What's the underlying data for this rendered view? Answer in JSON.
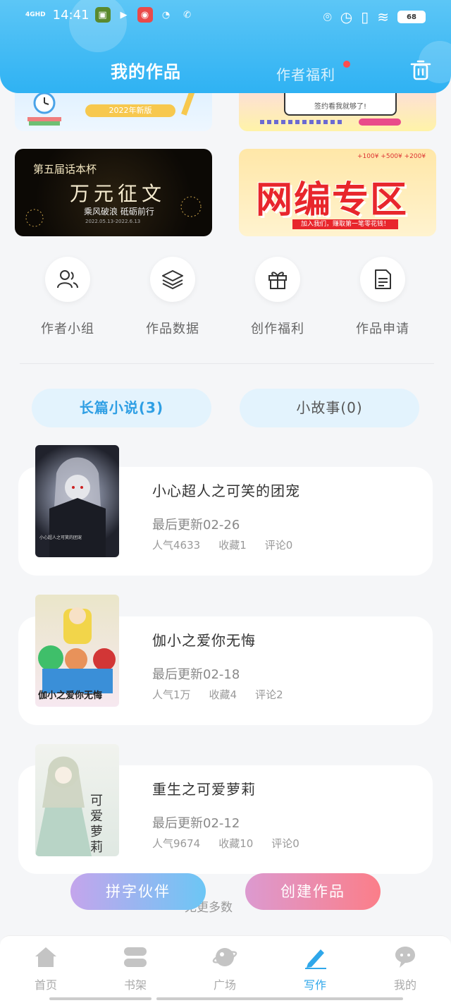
{
  "status_bar": {
    "network": "4GHD",
    "time": "14:41",
    "battery": "68"
  },
  "header": {
    "tab_my_works": "我的作品",
    "tab_author_benefits": "作者福利"
  },
  "banners": {
    "b1_pill": "2022年新版",
    "b2_card_text": "签约看我就够了!",
    "b3_line1": "第五届话本杯",
    "b3_line2": "万元征文",
    "b3_line3": "乘风破浪 砥砺前行",
    "b3_line4": "2022.05.13-2022.6.13",
    "b4_title": "网编专区",
    "b4_strip": "加入我们，赚取第一笔零花钱！",
    "b4_money": "+100¥ +500¥ +200¥"
  },
  "quick_actions": [
    {
      "label": "作者小组"
    },
    {
      "label": "作品数据"
    },
    {
      "label": "创作福利"
    },
    {
      "label": "作品申请"
    }
  ],
  "categories": {
    "novel": "长篇小说(3)",
    "story": "小故事(0)"
  },
  "works": [
    {
      "title": "小心超人之可笑的团宠",
      "update": "最后更新02-26",
      "popularity": "人气4633",
      "favorites": "收藏1",
      "comments": "评论0",
      "cover_text": "小心超人之可笑的团宠"
    },
    {
      "title": "伽小之爱你无悔",
      "update": "最后更新02-18",
      "popularity": "人气1万",
      "favorites": "收藏4",
      "comments": "评论2",
      "cover_text": "伽小之爱你无悔"
    },
    {
      "title": "重生之可爱萝莉",
      "update": "最后更新02-12",
      "popularity": "人气9674",
      "favorites": "收藏10",
      "comments": "评论0",
      "cover_text": "可爱萝莉"
    }
  ],
  "footer_text": "无更多数",
  "buttons": {
    "partner": "拼字伙伴",
    "create": "创建作品"
  },
  "bottom_nav": [
    {
      "label": "首页",
      "icon": "home-icon"
    },
    {
      "label": "书架",
      "icon": "bookshelf-icon"
    },
    {
      "label": "广场",
      "icon": "planet-icon"
    },
    {
      "label": "写作",
      "icon": "pen-icon"
    },
    {
      "label": "我的",
      "icon": "chat-bubble-icon"
    }
  ],
  "colors": {
    "header": "#2fb2f3",
    "accent": "#2f9fe4",
    "create_button": "#fb7e89"
  }
}
